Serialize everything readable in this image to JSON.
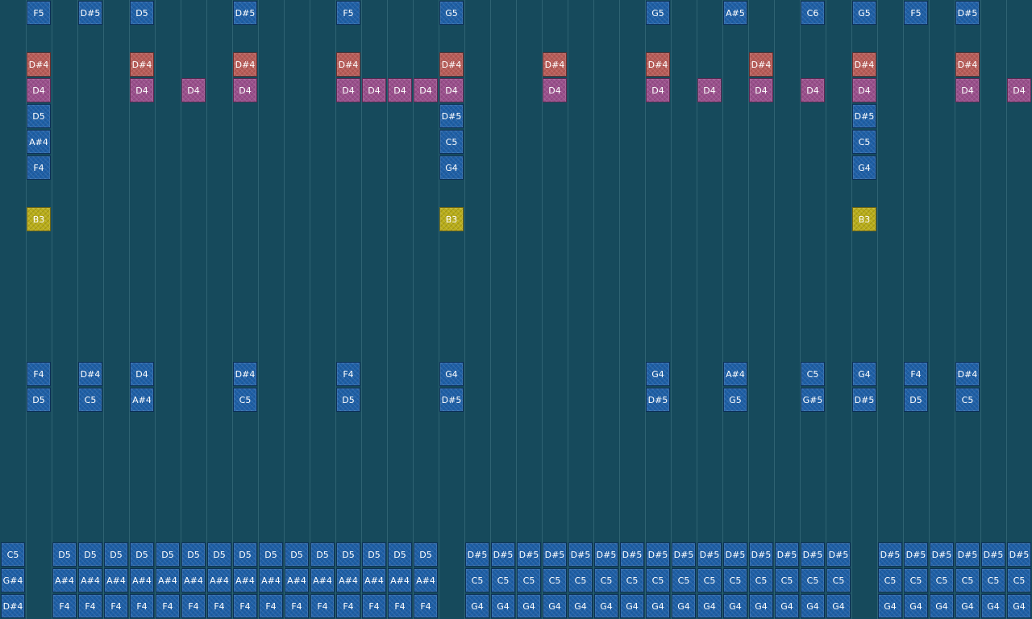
{
  "colors": {
    "background": "#164a5c",
    "gridline": "#2f6373",
    "blue": "#1e5fa6",
    "red": "#b85c58",
    "pink": "#9a4f8c",
    "yellow": "#b9ad18"
  },
  "notes": [
    {
      "label": "F5",
      "color": "blue",
      "col": 1,
      "row": 0
    },
    {
      "label": "D#5",
      "color": "blue",
      "col": 3,
      "row": 0
    },
    {
      "label": "D5",
      "color": "blue",
      "col": 5,
      "row": 0
    },
    {
      "label": "D#5",
      "color": "blue",
      "col": 9,
      "row": 0
    },
    {
      "label": "F5",
      "color": "blue",
      "col": 13,
      "row": 0
    },
    {
      "label": "G5",
      "color": "blue",
      "col": 17,
      "row": 0
    },
    {
      "label": "G5",
      "color": "blue",
      "col": 25,
      "row": 0
    },
    {
      "label": "A#5",
      "color": "blue",
      "col": 28,
      "row": 0
    },
    {
      "label": "C6",
      "color": "blue",
      "col": 31,
      "row": 0
    },
    {
      "label": "G5",
      "color": "blue",
      "col": 33,
      "row": 0
    },
    {
      "label": "F5",
      "color": "blue",
      "col": 35,
      "row": 0
    },
    {
      "label": "D#5",
      "color": "blue",
      "col": 37,
      "row": 0
    },
    {
      "label": "D#4",
      "color": "red",
      "col": 1,
      "row": 2
    },
    {
      "label": "D#4",
      "color": "red",
      "col": 5,
      "row": 2
    },
    {
      "label": "D#4",
      "color": "red",
      "col": 9,
      "row": 2
    },
    {
      "label": "D#4",
      "color": "red",
      "col": 13,
      "row": 2
    },
    {
      "label": "D#4",
      "color": "red",
      "col": 17,
      "row": 2
    },
    {
      "label": "D#4",
      "color": "red",
      "col": 21,
      "row": 2
    },
    {
      "label": "D#4",
      "color": "red",
      "col": 25,
      "row": 2
    },
    {
      "label": "D#4",
      "color": "red",
      "col": 29,
      "row": 2
    },
    {
      "label": "D#4",
      "color": "red",
      "col": 33,
      "row": 2
    },
    {
      "label": "D#4",
      "color": "red",
      "col": 37,
      "row": 2
    },
    {
      "label": "D4",
      "color": "pink",
      "col": 1,
      "row": 3
    },
    {
      "label": "D4",
      "color": "pink",
      "col": 5,
      "row": 3
    },
    {
      "label": "D4",
      "color": "pink",
      "col": 7,
      "row": 3
    },
    {
      "label": "D4",
      "color": "pink",
      "col": 9,
      "row": 3
    },
    {
      "label": "D4",
      "color": "pink",
      "col": 13,
      "row": 3
    },
    {
      "label": "D4",
      "color": "pink",
      "col": 14,
      "row": 3
    },
    {
      "label": "D4",
      "color": "pink",
      "col": 15,
      "row": 3
    },
    {
      "label": "D4",
      "color": "pink",
      "col": 16,
      "row": 3
    },
    {
      "label": "D4",
      "color": "pink",
      "col": 17,
      "row": 3
    },
    {
      "label": "D4",
      "color": "pink",
      "col": 21,
      "row": 3
    },
    {
      "label": "D4",
      "color": "pink",
      "col": 25,
      "row": 3
    },
    {
      "label": "D4",
      "color": "pink",
      "col": 27,
      "row": 3
    },
    {
      "label": "D4",
      "color": "pink",
      "col": 29,
      "row": 3
    },
    {
      "label": "D4",
      "color": "pink",
      "col": 31,
      "row": 3
    },
    {
      "label": "D4",
      "color": "pink",
      "col": 33,
      "row": 3
    },
    {
      "label": "D4",
      "color": "pink",
      "col": 37,
      "row": 3
    },
    {
      "label": "D4",
      "color": "pink",
      "col": 39,
      "row": 3
    },
    {
      "label": "D5",
      "color": "blue",
      "col": 1,
      "row": 4
    },
    {
      "label": "D#5",
      "color": "blue",
      "col": 17,
      "row": 4
    },
    {
      "label": "D#5",
      "color": "blue",
      "col": 33,
      "row": 4
    },
    {
      "label": "A#4",
      "color": "blue",
      "col": 1,
      "row": 5
    },
    {
      "label": "C5",
      "color": "blue",
      "col": 17,
      "row": 5
    },
    {
      "label": "C5",
      "color": "blue",
      "col": 33,
      "row": 5
    },
    {
      "label": "F4",
      "color": "blue",
      "col": 1,
      "row": 6
    },
    {
      "label": "G4",
      "color": "blue",
      "col": 17,
      "row": 6
    },
    {
      "label": "G4",
      "color": "blue",
      "col": 33,
      "row": 6
    },
    {
      "label": "B3",
      "color": "yellow",
      "col": 1,
      "row": 8
    },
    {
      "label": "B3",
      "color": "yellow",
      "col": 17,
      "row": 8
    },
    {
      "label": "B3",
      "color": "yellow",
      "col": 33,
      "row": 8
    },
    {
      "label": "F4",
      "color": "blue",
      "col": 1,
      "row": 14
    },
    {
      "label": "D#4",
      "color": "blue",
      "col": 3,
      "row": 14
    },
    {
      "label": "D4",
      "color": "blue",
      "col": 5,
      "row": 14
    },
    {
      "label": "D#4",
      "color": "blue",
      "col": 9,
      "row": 14
    },
    {
      "label": "F4",
      "color": "blue",
      "col": 13,
      "row": 14
    },
    {
      "label": "G4",
      "color": "blue",
      "col": 17,
      "row": 14
    },
    {
      "label": "G4",
      "color": "blue",
      "col": 25,
      "row": 14
    },
    {
      "label": "A#4",
      "color": "blue",
      "col": 28,
      "row": 14
    },
    {
      "label": "C5",
      "color": "blue",
      "col": 31,
      "row": 14
    },
    {
      "label": "G4",
      "color": "blue",
      "col": 33,
      "row": 14
    },
    {
      "label": "F4",
      "color": "blue",
      "col": 35,
      "row": 14
    },
    {
      "label": "D#4",
      "color": "blue",
      "col": 37,
      "row": 14
    },
    {
      "label": "D5",
      "color": "blue",
      "col": 1,
      "row": 15
    },
    {
      "label": "C5",
      "color": "blue",
      "col": 3,
      "row": 15
    },
    {
      "label": "A#4",
      "color": "blue",
      "col": 5,
      "row": 15
    },
    {
      "label": "C5",
      "color": "blue",
      "col": 9,
      "row": 15
    },
    {
      "label": "D5",
      "color": "blue",
      "col": 13,
      "row": 15
    },
    {
      "label": "D#5",
      "color": "blue",
      "col": 17,
      "row": 15
    },
    {
      "label": "D#5",
      "color": "blue",
      "col": 25,
      "row": 15
    },
    {
      "label": "G5",
      "color": "blue",
      "col": 28,
      "row": 15
    },
    {
      "label": "G#5",
      "color": "blue",
      "col": 31,
      "row": 15
    },
    {
      "label": "D#5",
      "color": "blue",
      "col": 33,
      "row": 15
    },
    {
      "label": "D5",
      "color": "blue",
      "col": 35,
      "row": 15
    },
    {
      "label": "C5",
      "color": "blue",
      "col": 37,
      "row": 15
    }
  ],
  "chords": {
    "groups": [
      {
        "cols": [
          0
        ],
        "top": "C5",
        "mid": "G#4",
        "bot": "D#4"
      },
      {
        "cols": [
          2,
          3,
          4,
          5,
          6,
          7,
          8,
          9,
          10,
          11,
          12,
          13,
          14,
          15,
          16
        ],
        "top": "D5",
        "mid": "A#4",
        "bot": "F4"
      },
      {
        "cols": [
          18,
          19,
          20,
          21,
          22,
          23,
          24,
          25,
          26,
          27,
          28,
          29,
          30,
          31,
          32
        ],
        "top": "D#5",
        "mid": "C5",
        "bot": "G4"
      },
      {
        "cols": [
          34,
          35,
          36,
          37,
          38,
          39
        ],
        "top": "D#5",
        "mid": "C5",
        "bot": "G4"
      }
    ]
  }
}
